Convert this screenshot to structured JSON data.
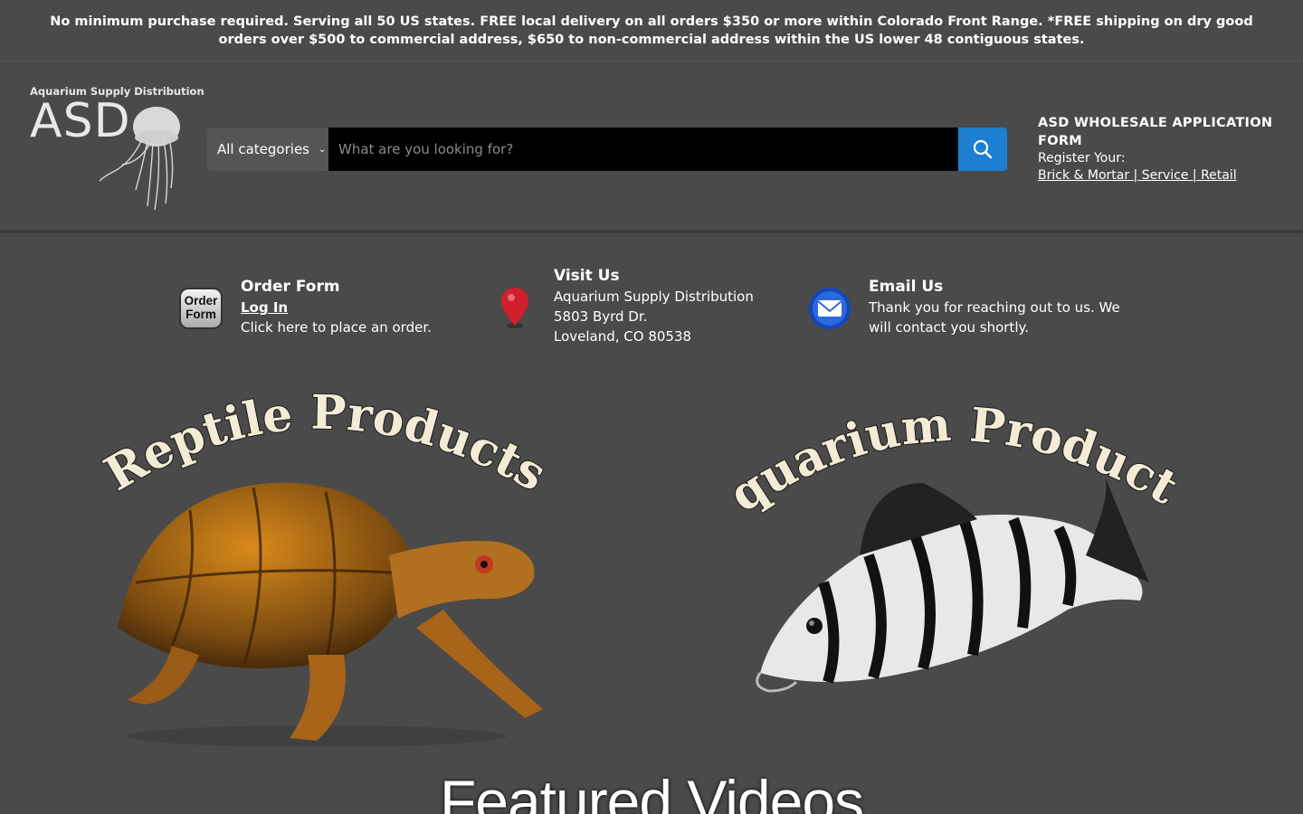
{
  "announcement": "No minimum purchase required. Serving all 50 US states. FREE local delivery on all orders $350 or more within Colorado Front Range. *FREE shipping on dry good orders over $500 to commercial address, $650 to non-commercial address within the US lower 48 contiguous states.",
  "logo": {
    "small": "Aquarium Supply Distribution",
    "big": "ASD"
  },
  "search": {
    "category": "All categories",
    "placeholder": "What are you looking for?"
  },
  "wholesale": {
    "title": "ASD WHOLESALE APPLICATION FORM",
    "register": "Register Your:",
    "links": "Brick & Mortar | Service | Retail"
  },
  "info": {
    "order": {
      "icon_text_1": "Order",
      "icon_text_2": "Form",
      "title": "Order Form",
      "link": "Log In",
      "desc": "Click here to place an order."
    },
    "visit": {
      "title": "Visit Us",
      "line1": "Aquarium Supply Distribution",
      "line2": "5803 Byrd Dr.",
      "line3": "Loveland, CO 80538"
    },
    "email": {
      "title": "Email Us",
      "line1": "Thank you for reaching out to us. We",
      "line2": "will contact you shortly."
    }
  },
  "promos": {
    "reptile": "Reptile Products",
    "aquarium": "Aquarium Products"
  },
  "featured": "Featured Videos",
  "colors": {
    "accent": "#1d7fd0",
    "background": "#4a4a4a",
    "search_bg": "#000000"
  }
}
